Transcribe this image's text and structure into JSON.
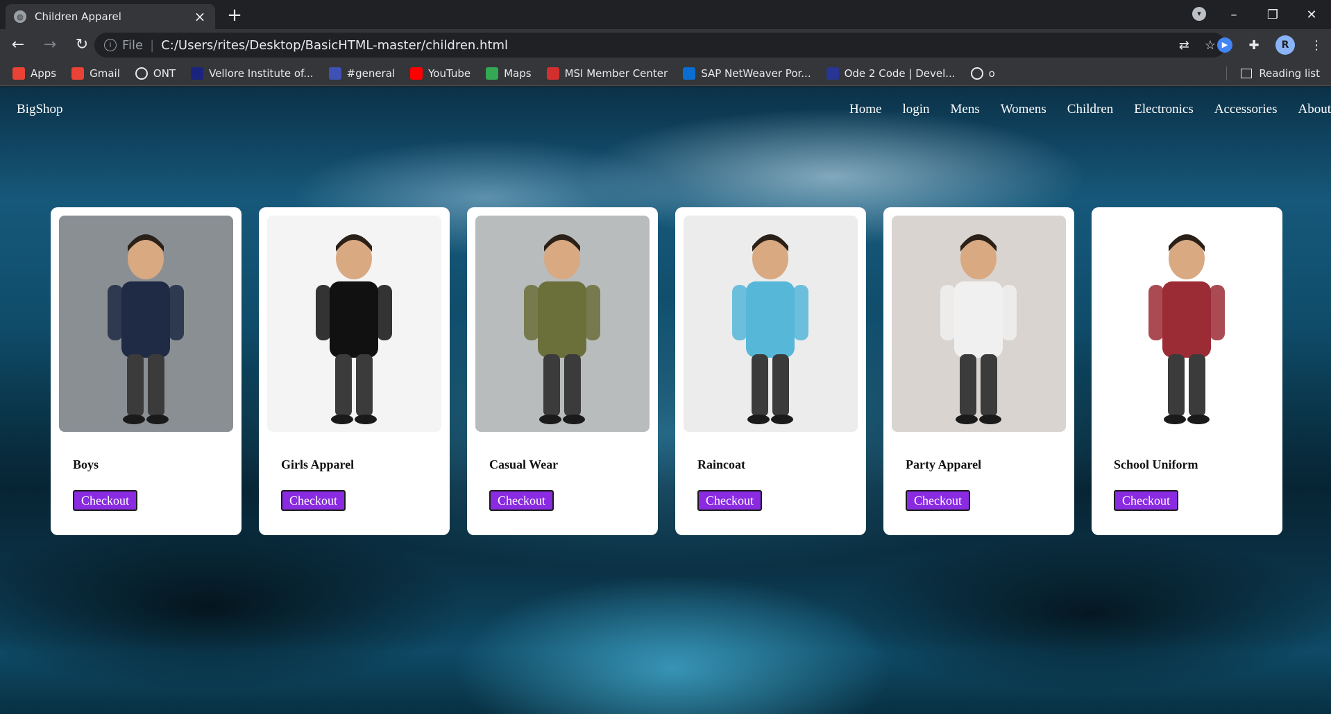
{
  "browser": {
    "tab": {
      "title": "Children Apparel"
    },
    "url": {
      "scheme": "File",
      "path": "C:/Users/rites/Desktop/BasicHTML-master/children.html"
    },
    "bookmarks": [
      {
        "label": "Apps",
        "icon": "apps-grid-icon",
        "color": "#ea4335"
      },
      {
        "label": "Gmail",
        "icon": "gmail-icon",
        "color": "#ea4335"
      },
      {
        "label": "ONT",
        "icon": "globe-icon",
        "color": "#e8eaed"
      },
      {
        "label": "Vellore Institute of...",
        "icon": "vit-icon",
        "color": "#1a237e"
      },
      {
        "label": "#general",
        "icon": "chat-badge-icon",
        "color": "#3f51b5"
      },
      {
        "label": "YouTube",
        "icon": "youtube-icon",
        "color": "#ff0000"
      },
      {
        "label": "Maps",
        "icon": "maps-pin-icon",
        "color": "#34a853"
      },
      {
        "label": "MSI Member Center",
        "icon": "msi-shield-icon",
        "color": "#d32f2f"
      },
      {
        "label": "SAP NetWeaver Por...",
        "icon": "sap-icon",
        "color": "#0a6ed1"
      },
      {
        "label": "Ode 2 Code | Devel...",
        "icon": "ode2code-icon",
        "color": "#283593"
      },
      {
        "label": "o",
        "icon": "globe-icon",
        "color": "#e8eaed"
      }
    ],
    "reading_list": "Reading list"
  },
  "site": {
    "brand": "BigShop",
    "menu": [
      "Home",
      "login",
      "Mens",
      "Womens",
      "Children",
      "Electronics",
      "Accessories",
      "About"
    ],
    "cards": [
      {
        "title": "Boys",
        "button": "Checkout",
        "image": "boy-in-vest-sunglasses-photo",
        "bg": "#8a8f94",
        "accent": "#1f2a44"
      },
      {
        "title": "Girls Apparel",
        "button": "Checkout",
        "image": "girl-in-floral-dress-photo",
        "bg": "#f4f4f4",
        "accent": "#111111"
      },
      {
        "title": "Casual Wear",
        "button": "Checkout",
        "image": "boy-in-plaid-shirt-photo",
        "bg": "#b9bcbd",
        "accent": "#6b6f3a"
      },
      {
        "title": "Raincoat",
        "button": "Checkout",
        "image": "boy-in-blue-raincoat-photo",
        "bg": "#ececec",
        "accent": "#56b7d9"
      },
      {
        "title": "Party Apparel",
        "button": "Checkout",
        "image": "baby-in-vest-bowtie-photo",
        "bg": "#d9d4cf",
        "accent": "#f0f0f0"
      },
      {
        "title": "School Uniform",
        "button": "Checkout",
        "image": "boy-in-school-uniform-photo",
        "bg": "#ffffff",
        "accent": "#9b2c35"
      }
    ],
    "colors": {
      "button_bg": "#8a2be2",
      "card_bg": "#ffffff"
    }
  }
}
